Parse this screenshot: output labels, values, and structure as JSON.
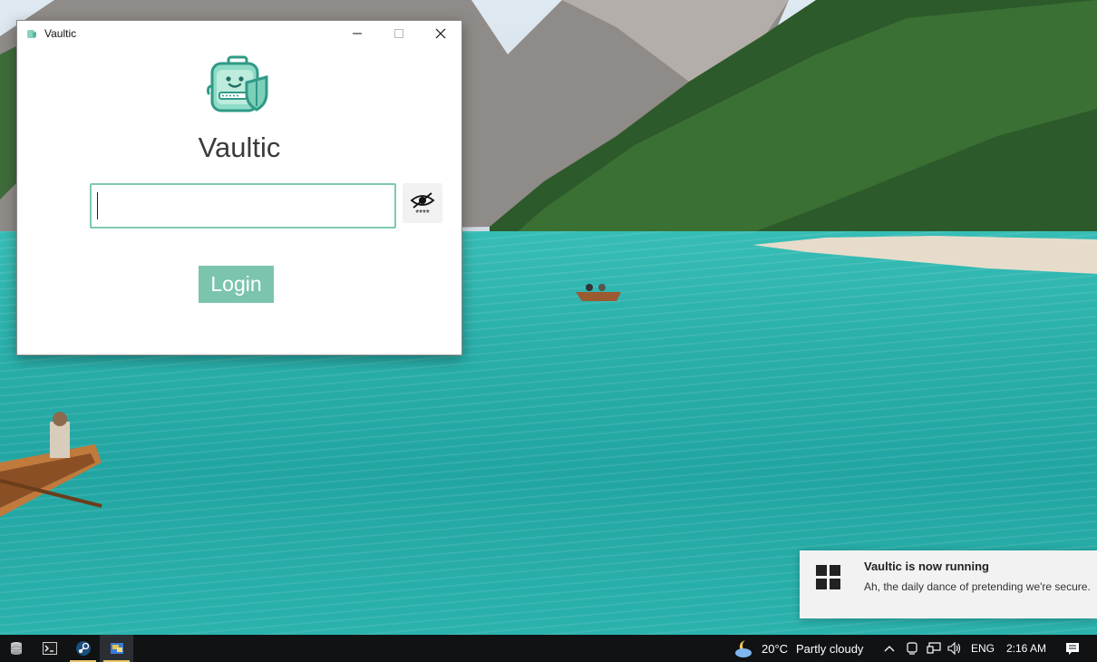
{
  "window": {
    "title": "Vaultic",
    "app_name": "Vaultic",
    "password_value": "",
    "password_placeholder": "",
    "login_label": "Login",
    "toggle_mask_text": "****"
  },
  "colors": {
    "accent": "#7bc4ae",
    "input_border": "#7ec8b4",
    "taskbar": "#101214"
  },
  "icons": {
    "app": "vault-briefcase-shield-icon",
    "minimize": "minimize-icon",
    "maximize": "maximize-icon",
    "close": "close-icon",
    "toggle": "eye-slash-icon"
  },
  "notification": {
    "title": "Vaultic is now running",
    "body": "Ah, the daily dance of pretending we're secure."
  },
  "taskbar": {
    "apps": [
      "database-icon",
      "terminal-icon",
      "steam-icon",
      "vaultic-app-icon"
    ],
    "weather_temp": "20°C",
    "weather_desc": "Partly cloudy",
    "language": "ENG",
    "time": "2:16 AM"
  }
}
